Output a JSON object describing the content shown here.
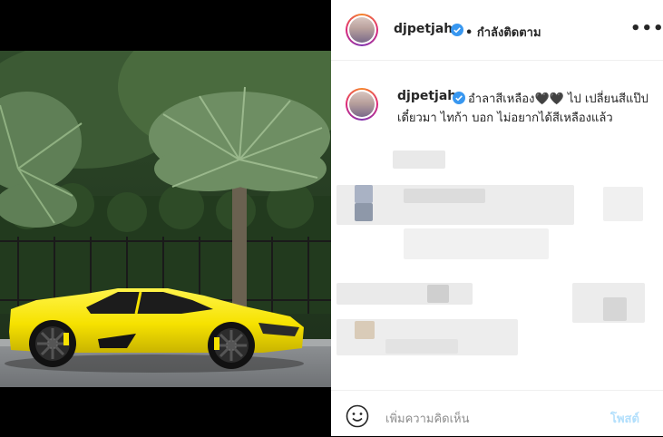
{
  "post": {
    "username": "djpetjah",
    "follow_status": "• กำลังติดตาม",
    "more_label": "•••",
    "caption": "อำลาสีเหลือง🖤🖤 ไป เปลี่ยนสีแป๊ป เดี๋ยวมา ไทก้า บอก ไม่อยากได้สีเหลืองแล้ว"
  },
  "comment_box": {
    "placeholder": "เพิ่มความคิดเห็น",
    "post_label": "โพสต์"
  },
  "colors": {
    "verified": "#3897f0",
    "post_button_disabled": "#b2dffc",
    "car": "#f6e200"
  },
  "icons": [
    "verified-badge-icon",
    "more-options-icon",
    "emoji-icon"
  ]
}
